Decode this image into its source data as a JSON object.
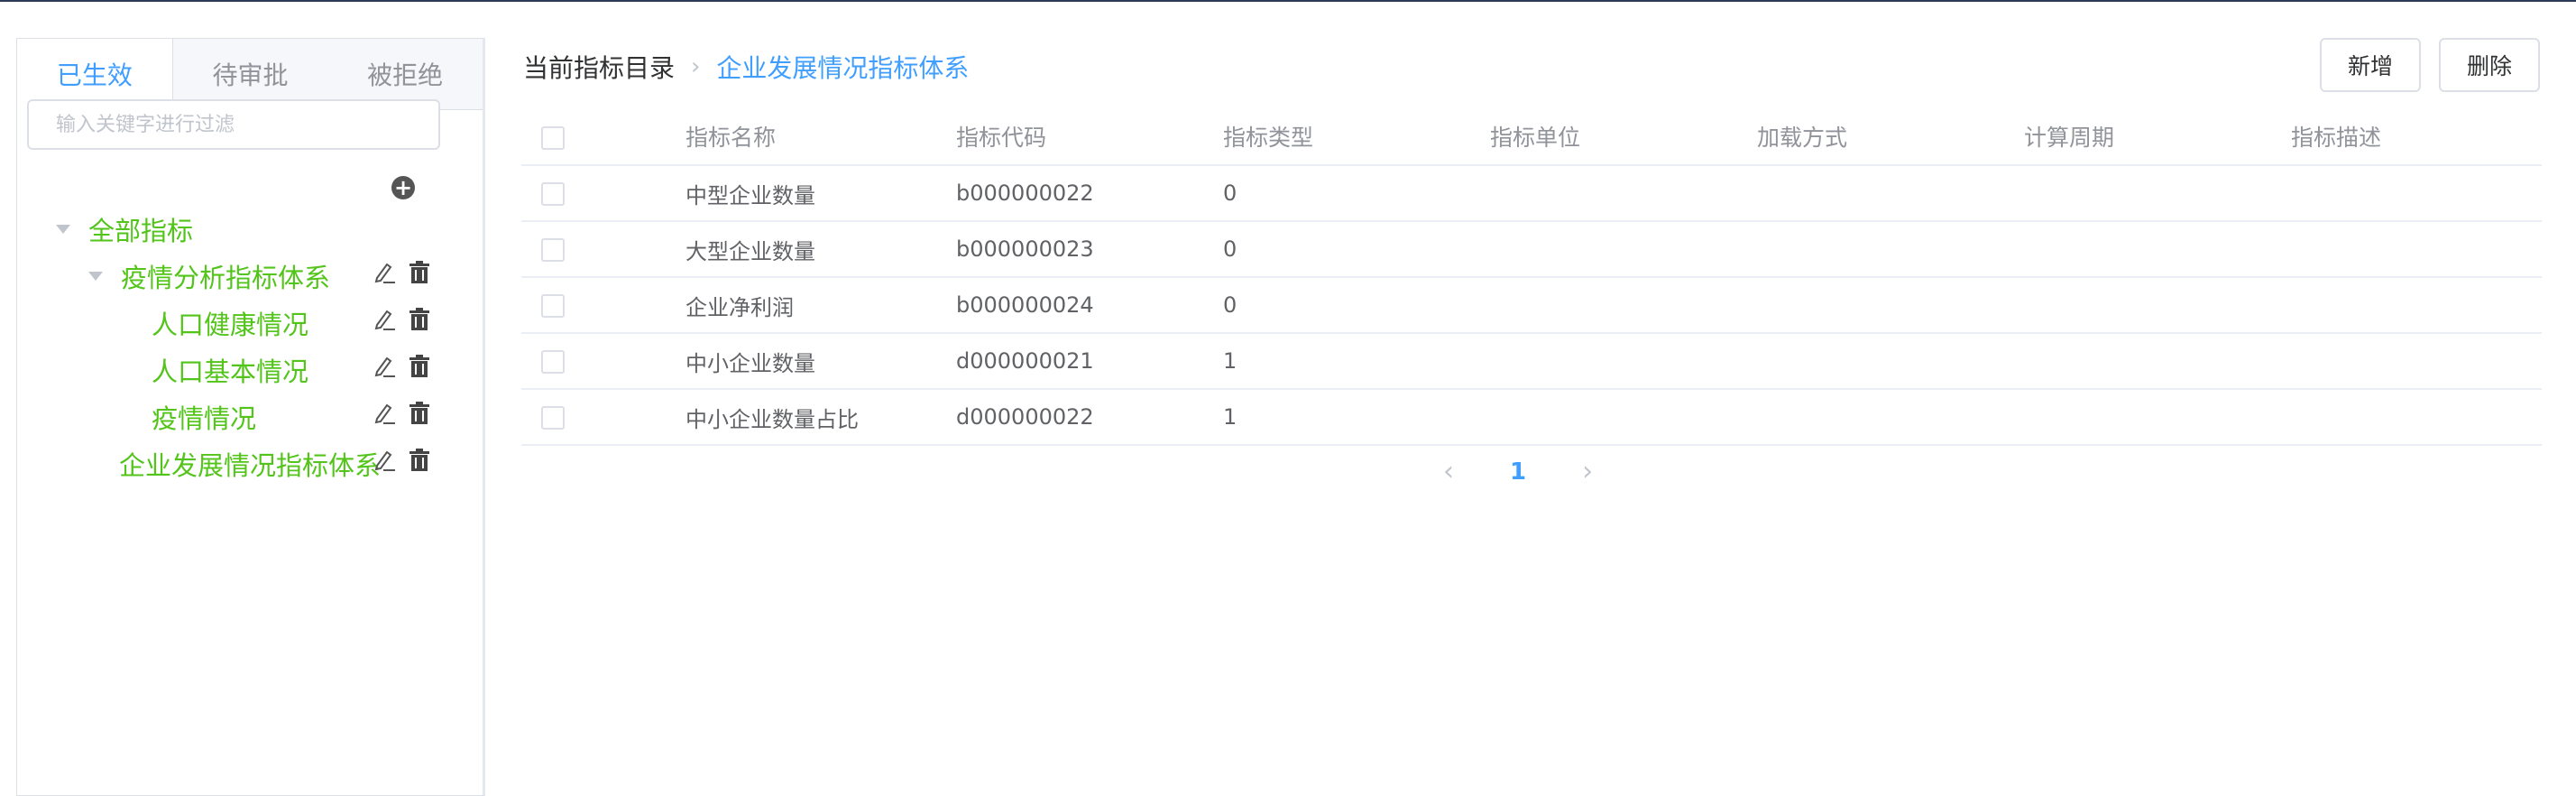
{
  "sidebar": {
    "tabs": [
      "已生效",
      "待审批",
      "被拒绝"
    ],
    "filter_placeholder": "输入关键字进行过滤",
    "tree": {
      "root": "全部指标",
      "group1": "疫情分析指标体系",
      "child1": "人口健康情况",
      "child2": "人口基本情况",
      "child3": "疫情情况",
      "group2": "企业发展情况指标体系"
    }
  },
  "breadcrumb": {
    "root": "当前指标目录",
    "separator": "›",
    "current": "企业发展情况指标体系"
  },
  "toolbar": {
    "add_label": "新增",
    "delete_label": "删除"
  },
  "table": {
    "columns": [
      "指标名称",
      "指标代码",
      "指标类型",
      "指标单位",
      "加载方式",
      "计算周期",
      "指标描述"
    ],
    "rows": [
      [
        "中型企业数量",
        "b000000022",
        "0",
        "",
        "",
        "",
        ""
      ],
      [
        "大型企业数量",
        "b000000023",
        "0",
        "",
        "",
        "",
        ""
      ],
      [
        "企业净利润",
        "b000000024",
        "0",
        "",
        "",
        "",
        ""
      ],
      [
        "中小企业数量",
        "d000000021",
        "1",
        "",
        "",
        "",
        ""
      ],
      [
        "中小企业数量占比",
        "d000000022",
        "1",
        "",
        "",
        "",
        ""
      ]
    ]
  },
  "pagination": {
    "prev": "‹",
    "current": "1",
    "next": "›"
  },
  "colors": {
    "accent": "#409eff",
    "tree_node": "#52c41a"
  }
}
